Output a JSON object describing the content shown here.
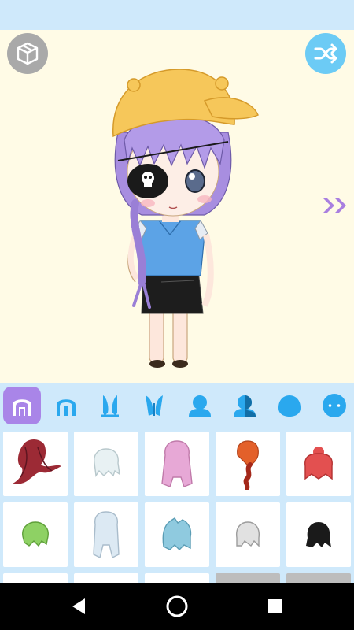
{
  "colors": {
    "stage_bg": "#fffbe6",
    "panel_bg": "#cfe9fb",
    "tab_icon": "#2aa8ee",
    "active_tab": "#a985e8",
    "arrow": "#a97fe0",
    "random_button": "#6ccbf5",
    "view3d_button": "#a9a9a9"
  },
  "toolbar": {
    "view3d_icon": "cube-icon",
    "random_icon": "shuffle-icon",
    "next_icon": "double-chevron-right-icon"
  },
  "tabs": [
    {
      "icon": "front-hair-icon",
      "active": true
    },
    {
      "icon": "side-hair-icon",
      "active": false
    },
    {
      "icon": "bunny-ears-icon",
      "active": false
    },
    {
      "icon": "bunny-ears-alt-icon",
      "active": false
    },
    {
      "icon": "body-silhouette-icon",
      "active": false
    },
    {
      "icon": "body-half-icon",
      "active": false
    },
    {
      "icon": "head-shape-icon",
      "active": false
    },
    {
      "icon": "face-icon",
      "active": false
    }
  ],
  "hair_options": [
    {
      "color": "#9c2a35",
      "style": "long-curly"
    },
    {
      "color": "#e8f1f3",
      "style": "bob"
    },
    {
      "color": "#e7a8d6",
      "style": "long"
    },
    {
      "color": "#e3602a",
      "style": "braid"
    },
    {
      "color": "#e35050",
      "style": "bun"
    },
    {
      "color": "#8ed164",
      "style": "short"
    },
    {
      "color": "#dce9f3",
      "style": "long"
    },
    {
      "color": "#8fcadf",
      "style": "messy"
    },
    {
      "color": "#e1e1e1",
      "style": "bob"
    },
    {
      "color": "#1a1a1a",
      "style": "messy"
    }
  ],
  "navigation": {
    "back_icon": "back-triangle-icon",
    "home_icon": "home-circle-icon",
    "recents_icon": "recents-square-icon"
  }
}
